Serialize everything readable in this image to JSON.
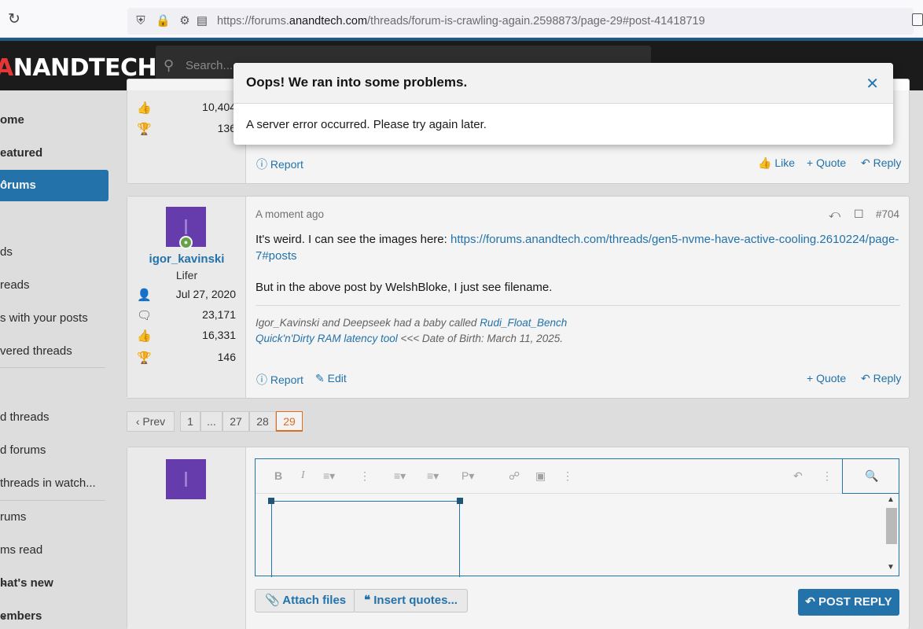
{
  "browser": {
    "url_prefix": "https://forums.",
    "url_domain": "anandtech.com",
    "url_path": "/threads/forum-is-crawling-again.2598873/page-29#post-41418719"
  },
  "site": {
    "logo_first": "A",
    "logo_rest": "NANDTECH",
    "search_placeholder": "Search..."
  },
  "sidebar": {
    "items": [
      {
        "label": "ome"
      },
      {
        "label": "eatured"
      },
      {
        "label": "orums"
      },
      {
        "label": "ds"
      },
      {
        "label": "reads"
      },
      {
        "label": "s with your posts"
      },
      {
        "label": "vered threads"
      },
      {
        "label": "d threads"
      },
      {
        "label": "d forums"
      },
      {
        "label": "threads in watch..."
      },
      {
        "label": "rums"
      },
      {
        "label": "ms read"
      },
      {
        "label": "hat's new"
      },
      {
        "label": "embers"
      }
    ]
  },
  "prev_post": {
    "stats": [
      "10,404",
      "136"
    ],
    "report": "Report",
    "like": "Like",
    "quote": "Quote",
    "reply": "Reply"
  },
  "post": {
    "avatar_letter": "I",
    "username": "igor_kavinski",
    "title": "Lifer",
    "joined": "Jul 27, 2020",
    "messages": "23,171",
    "reactions": "16,331",
    "points": "146",
    "time": "A moment ago",
    "number": "#704",
    "body_prefix": "It's weird. I can see the images here: ",
    "body_link": "https://forums.anandtech.com/threads/gen5-nvme-have-active-cooling.2610224/page-7#posts",
    "body_2": "But in the above post by WelshBloke, I just see filename.",
    "sig_prefix": "Igor_Kavinski and Deepseek had a baby called ",
    "sig_link1": "Rudi_Float_Bench",
    "sig_link2": "Quick'n'Dirty RAM latency tool",
    "sig_suffix": " <<< Date of Birth: March 11, 2025.",
    "report": "Report",
    "edit": "Edit",
    "quote": "Quote",
    "reply": "Reply"
  },
  "pagination": {
    "prev": "Prev",
    "pages": [
      "1",
      "...",
      "27",
      "28",
      "29"
    ]
  },
  "editor": {
    "avatar_letter": "I",
    "attach": "Attach files",
    "insert_quotes": "Insert quotes...",
    "post_reply": "POST REPLY"
  },
  "modal": {
    "title": "Oops! We ran into some problems.",
    "message": "A server error occurred. Please try again later."
  },
  "colors": {
    "accent": "#2577b1",
    "current_page": "#e8731f",
    "avatar": "#6b3fb5"
  }
}
